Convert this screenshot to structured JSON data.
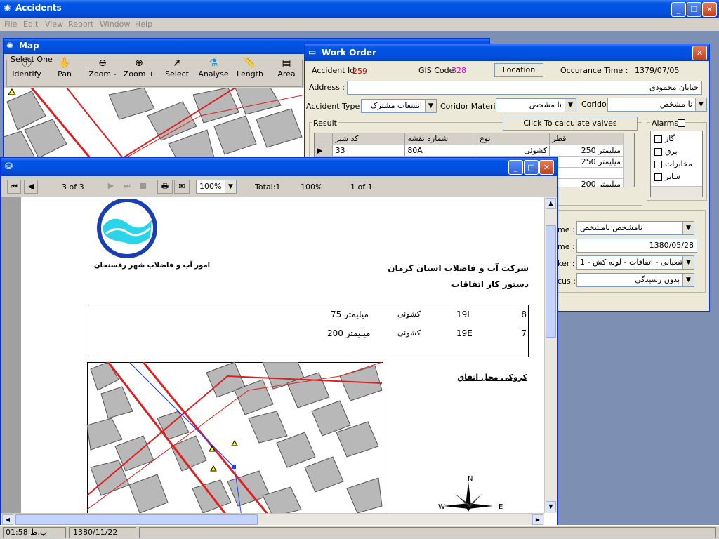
{
  "main_window": {
    "title": "Accidents",
    "menu": [
      "File",
      "Edit",
      "View",
      "Report",
      "Window",
      "Help"
    ]
  },
  "map_window": {
    "title": "Map",
    "toolbar_group_label": "Select One",
    "tools": [
      {
        "label": "Identify",
        "icon": "info-icon"
      },
      {
        "label": "Pan",
        "icon": "hand-icon"
      },
      {
        "label": "Zoom -",
        "icon": "zoom-out-icon"
      },
      {
        "label": "Zoom +",
        "icon": "zoom-in-icon"
      },
      {
        "label": "Select",
        "icon": "arrow-icon"
      },
      {
        "label": "Analyse",
        "icon": "analyse-icon"
      },
      {
        "label": "Length",
        "icon": "ruler-icon"
      },
      {
        "label": "Area",
        "icon": "area-icon"
      }
    ]
  },
  "work_order": {
    "title": "Work Order",
    "accident_id_label": "Accident Id",
    "accident_id_value": "259",
    "gis_code_label": "GIS Code",
    "gis_code_value": "328",
    "location_button": "Location",
    "occurance_label": "Occurance Time :",
    "occurance_value": "1379/07/05",
    "address_label": "Address :",
    "address_value": "خیابان محمودی",
    "accident_type_label": "Accident Type :",
    "accident_type_value": "انشعاب مشترک",
    "corridor_material_label": "Coridor Material",
    "corridor_material_value": "نا مشخص",
    "corridor_label": "Coridor",
    "corridor_value": "نا مشخص",
    "result_label": "Result",
    "calc_button": "Click To calculate valves",
    "grid_headers": [
      "کد شیر",
      "شماره نقشه",
      "نوع",
      "قطر"
    ],
    "grid_rows": [
      [
        "33",
        "80A",
        "کشوئی",
        "میلیمتر 250"
      ],
      [
        "",
        "",
        "",
        "میلیمتر 250"
      ],
      [
        "",
        "",
        "",
        ""
      ],
      [
        "",
        "",
        "",
        "میلیمتر 200"
      ]
    ],
    "alarms_label": "Alarms",
    "alarms": [
      "گاز",
      "برق",
      "مخابرات",
      "سایر"
    ],
    "form_rows": [
      {
        "label": "me :",
        "value": "نامشخص نامشخص"
      },
      {
        "label": "me :",
        "value": "1380/05/28"
      },
      {
        "label": "ker :",
        "value": "شعبانی - اتفاقات - لوله کش - 1"
      },
      {
        "label": "cus :",
        "value": "بدون رسیدگی"
      }
    ]
  },
  "report_window": {
    "title": "",
    "page_indicator": "3 of 3",
    "zoom": "100%",
    "total": "Total:1",
    "percent": "100%",
    "record": "1 of 1",
    "org_name": "امور آب و فاضلاب شهر رفسنجان",
    "company": "شرکت آب و فاضلاب استان کرمان",
    "doc_title": "دستور کار اتفاقات",
    "table_rows": [
      {
        "idx": "8",
        "code": "19I",
        "type": "کشوئی",
        "size": "میلیمتر 75"
      },
      {
        "idx": "7",
        "code": "19E",
        "type": "کشوئی",
        "size": "میلیمتر 200"
      }
    ],
    "map_caption": "کروکی محل اتفاق",
    "compass_n": "N",
    "compass_w": "W",
    "compass_e": "E"
  },
  "status_bar": {
    "time": "01:58 ب.ظ",
    "date": "1380/11/22"
  },
  "colors": {
    "xp_blue": "#0055e5",
    "face": "#d4d0c8",
    "pipe_red": "#e02020",
    "parcel_gray": "#b8b8b8"
  }
}
